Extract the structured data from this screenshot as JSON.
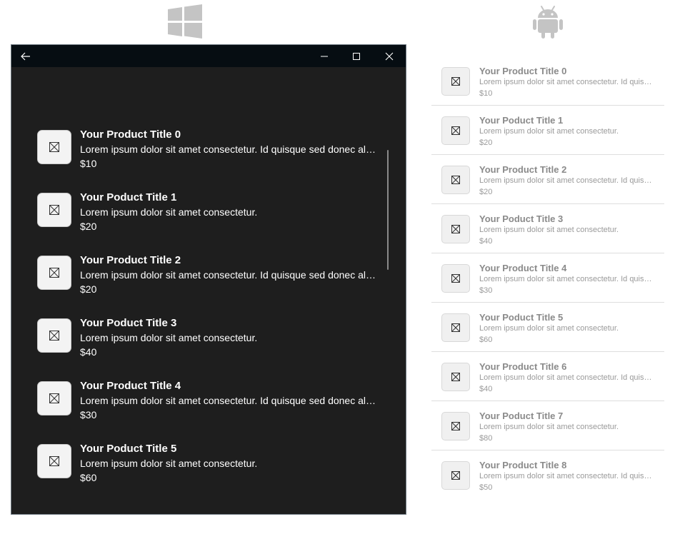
{
  "logos": {
    "windows_icon": "windows-logo",
    "android_icon": "android-logo",
    "logo_color": "#c4c4c4"
  },
  "titlebar": {
    "icons": [
      "back-arrow-icon",
      "minimize-icon",
      "maximize-icon",
      "close-icon"
    ]
  },
  "windows_list": {
    "items": [
      {
        "title": "Your Product Title 0",
        "description": "Lorem ipsum dolor sit amet consectetur. Id quisque sed donec aliquam",
        "price": "$10"
      },
      {
        "title": "Your Poduct Title 1",
        "description": "Lorem ipsum dolor sit amet consectetur.",
        "price": "$20"
      },
      {
        "title": "Your Product Title 2",
        "description": "Lorem ipsum dolor sit amet consectetur. Id quisque sed donec aliquam",
        "price": "$20"
      },
      {
        "title": "Your Poduct Title 3",
        "description": "Lorem ipsum dolor sit amet consectetur.",
        "price": "$40"
      },
      {
        "title": "Your Product Title 4",
        "description": "Lorem ipsum dolor sit amet consectetur. Id quisque sed donec aliquam",
        "price": "$30"
      },
      {
        "title": "Your Poduct Title 5",
        "description": "Lorem ipsum dolor sit amet consectetur.",
        "price": "$60"
      }
    ]
  },
  "android_list": {
    "items": [
      {
        "title": "Your Product Title 0",
        "description": "Lorem ipsum dolor sit amet consectetur. Id quisque sed donec aliquam",
        "price": "$10"
      },
      {
        "title": "Your Poduct Title 1",
        "description": "Lorem ipsum dolor sit amet consectetur.",
        "price": "$20"
      },
      {
        "title": "Your Product Title 2",
        "description": "Lorem ipsum dolor sit amet consectetur. Id quisque sed donec aliquam",
        "price": "$20"
      },
      {
        "title": "Your Poduct Title 3",
        "description": "Lorem ipsum dolor sit amet consectetur.",
        "price": "$40"
      },
      {
        "title": "Your Product Title 4",
        "description": "Lorem ipsum dolor sit amet consectetur. Id quisque sed donec aliquam",
        "price": "$30"
      },
      {
        "title": "Your Poduct Title 5",
        "description": "Lorem ipsum dolor sit amet consectetur.",
        "price": "$60"
      },
      {
        "title": "Your Product Title 6",
        "description": "Lorem ipsum dolor sit amet consectetur. Id quisque sed donec aliquam",
        "price": "$40"
      },
      {
        "title": "Your Poduct Title 7",
        "description": "Lorem ipsum dolor sit amet consectetur.",
        "price": "$80"
      },
      {
        "title": "Your Product Title 8",
        "description": "Lorem ipsum dolor sit amet consectetur. Id quisque sed donec aliquam",
        "price": "$50"
      }
    ]
  },
  "colors": {
    "window_background": "#1e1e1e",
    "titlebar_background": "#060d12",
    "thumbnail_background": "#f3f3f3"
  }
}
